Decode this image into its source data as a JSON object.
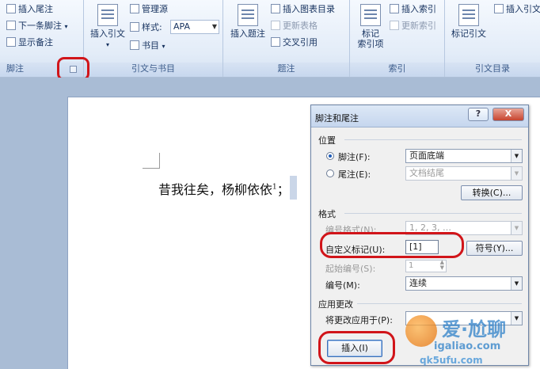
{
  "ribbon": {
    "footnotes": {
      "insert_endnote": "插入尾注",
      "next_footnote": "下一条脚注",
      "show_notes": "显示备注",
      "label": "脚注"
    },
    "citations": {
      "insert_citation": "插入引文",
      "manage_sources": "管理源",
      "style_label": "样式:",
      "style_value": "APA",
      "bibliography": "书目",
      "label": "引文与书目"
    },
    "captions": {
      "insert_caption": "插入题注",
      "insert_table_of_figures": "插入图表目录",
      "update_table": "更新表格",
      "cross_reference": "交叉引用",
      "label": "题注"
    },
    "index": {
      "mark_entry_line1": "标记",
      "mark_entry_line2": "索引项",
      "insert_index": "插入索引",
      "update_index": "更新索引",
      "label": "索引"
    },
    "toa": {
      "mark_citation": "标记引文",
      "insert_toa": "插入引文",
      "label": "引文目录"
    }
  },
  "document": {
    "text": "昔我往矣，杨柳依依",
    "superscript": "1",
    "trailing": "；"
  },
  "dialog": {
    "title": "脚注和尾注",
    "help": "?",
    "close": "X",
    "location": {
      "section": "位置",
      "footnote_label": "脚注(F):",
      "footnote_value": "页面底端",
      "endnote_label": "尾注(E):",
      "endnote_value": "文档结尾",
      "convert_button": "转换(C)..."
    },
    "format": {
      "section": "格式",
      "number_format_label": "编号格式(N):",
      "number_format_value": "1, 2, 3, …",
      "custom_mark_label": "自定义标记(U):",
      "custom_mark_value": "[1]",
      "symbol_button": "符号(Y)...",
      "start_at_label": "起始编号(S):",
      "start_at_value": "1",
      "numbering_label": "编号(M):",
      "numbering_value": "连续"
    },
    "apply": {
      "section": "应用更改",
      "apply_to_label": "将更改应用于(P):"
    },
    "insert_button": "插入(I)"
  },
  "watermark": {
    "line1": "爱·尬聊",
    "line2": "igaliao.com",
    "line3": "qk5ufu.com"
  },
  "colors": {
    "highlight": "#d1151a",
    "ribbon_text": "#15315e"
  }
}
